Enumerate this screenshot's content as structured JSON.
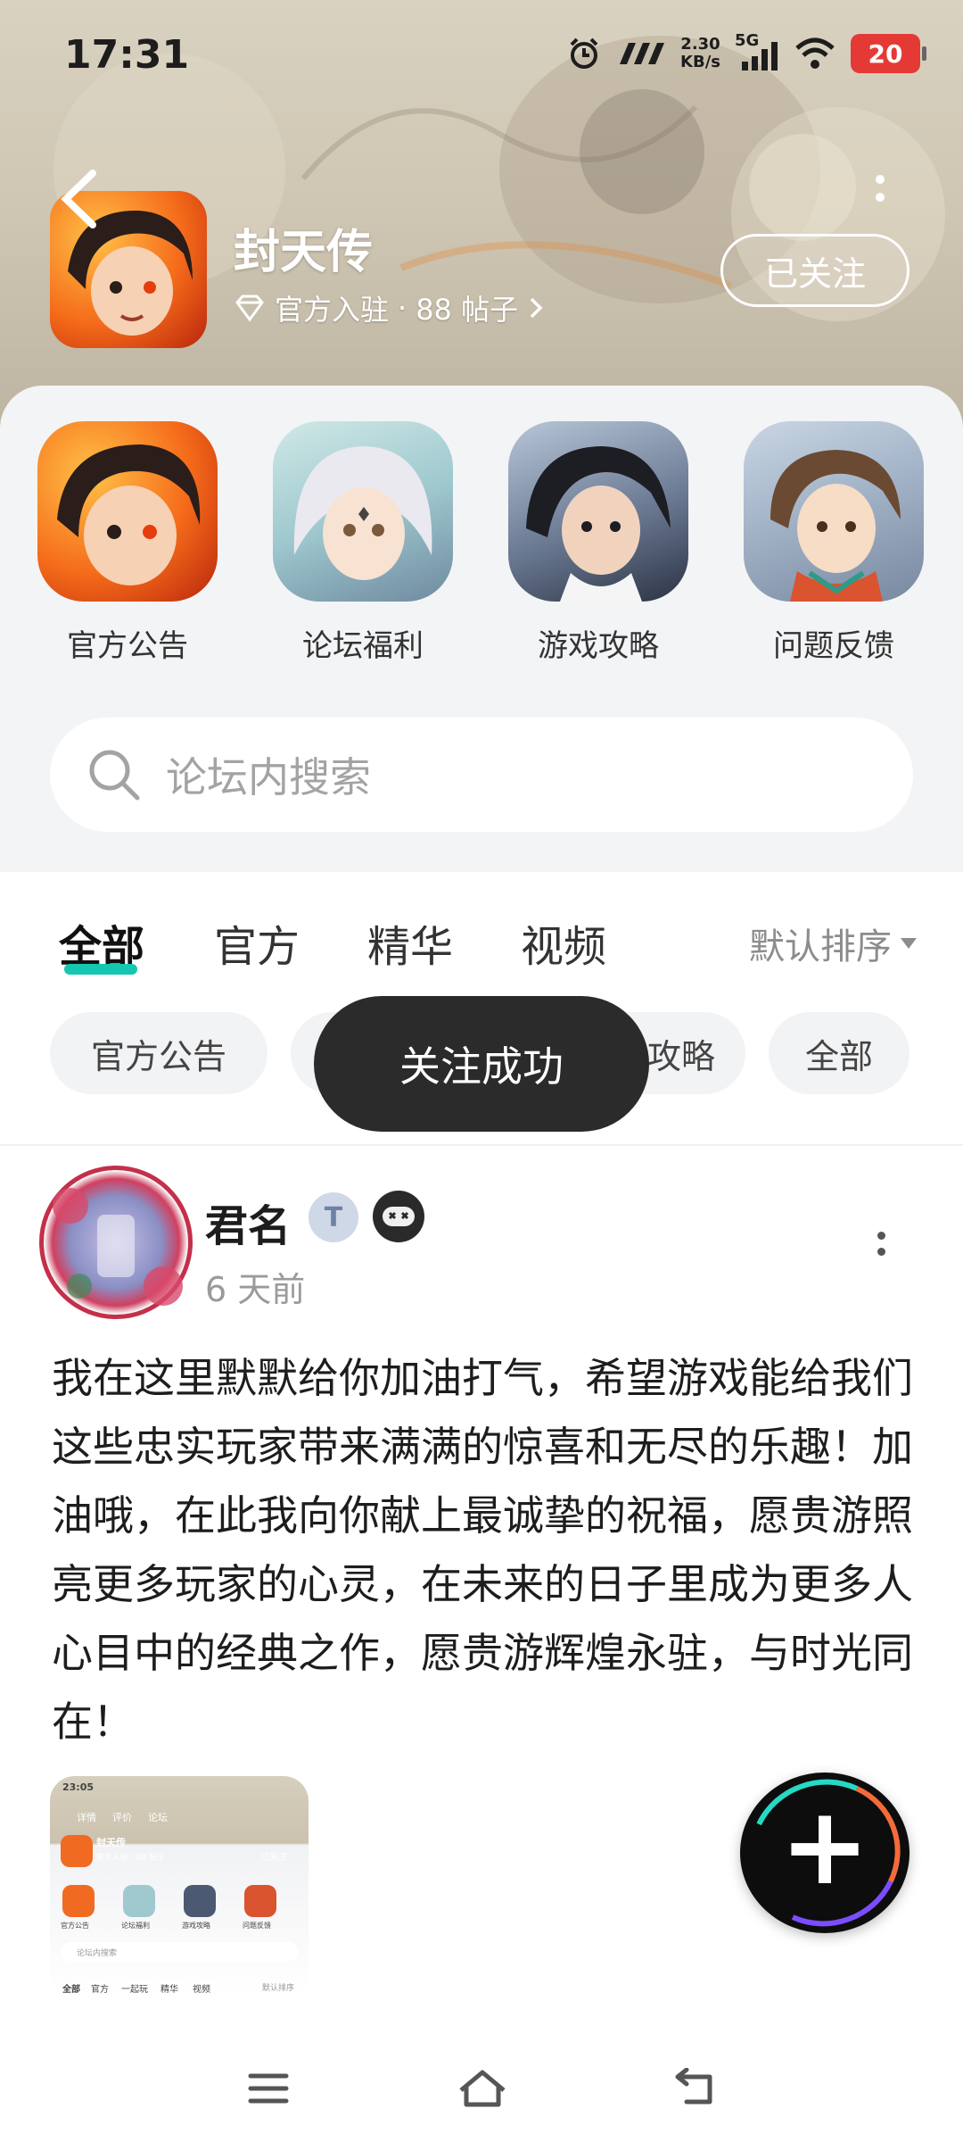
{
  "status_bar": {
    "time": "17:31",
    "net_speed_value": "2.30",
    "net_speed_unit": "KB/s",
    "network": "5G",
    "battery": "20"
  },
  "header": {
    "title": "封天传",
    "meta_official": "官方入驻",
    "meta_separator": "·",
    "meta_posts": "88 帖子",
    "follow_label": "已关注"
  },
  "categories": [
    {
      "label": "官方公告"
    },
    {
      "label": "论坛福利"
    },
    {
      "label": "游戏攻略"
    },
    {
      "label": "问题反馈"
    }
  ],
  "search": {
    "placeholder": "论坛内搜索"
  },
  "tabs": [
    {
      "label": "全部",
      "active": true
    },
    {
      "label": "官方"
    },
    {
      "label": "精华"
    },
    {
      "label": "视频"
    }
  ],
  "sort": {
    "label": "默认排序"
  },
  "chips": [
    {
      "label": "官方公告"
    },
    {
      "label": "攻略"
    },
    {
      "label": "全部"
    }
  ],
  "toast": {
    "label": "关注成功"
  },
  "post": {
    "username": "君名",
    "badge_text": "T",
    "time": "6 天前",
    "body": "我在这里默默给你加油打气，希望游戏能给我们这些忠实玩家带来满满的惊喜和无尽的乐趣！加油哦，在此我向你献上最诚挚的祝福，愿贵游照亮更多玩家的心灵，在未来的日子里成为更多人心目中的经典之作，愿贵游辉煌永驻，与时光同在！"
  },
  "thumbnail": {
    "time": "23:05",
    "title": "封天传",
    "meta": "官方入驻 · 88 帖子",
    "follow": "已关注",
    "categories": [
      "官方公告",
      "论坛福利",
      "游戏攻略",
      "问题反馈"
    ],
    "search": "论坛内搜索",
    "tabs": [
      "全部",
      "官方",
      "一起玩",
      "精华",
      "视频"
    ],
    "top_tabs": [
      "详情",
      "评价",
      "论坛"
    ],
    "sort": "默认排序"
  },
  "fab": {
    "icon": "plus-icon"
  },
  "colors": {
    "accent": "#15c7b1",
    "battery": "#e53935",
    "toast_bg": "#2b2b2b"
  }
}
